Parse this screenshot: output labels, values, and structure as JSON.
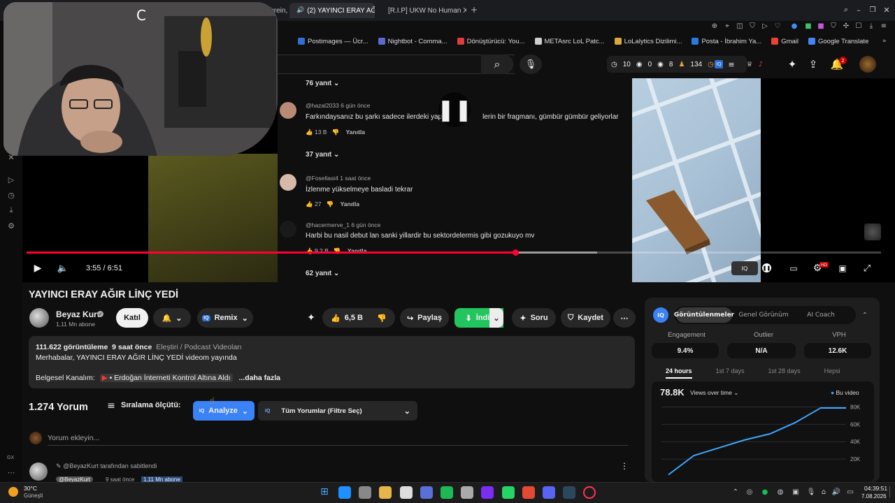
{
  "browser": {
    "tabs": [
      {
        "label": "Bahrein, c"
      },
      {
        "label": "(2) YAYINCI ERAY AĞIR"
      },
      {
        "label": "[R.I.P] UKW No Human Xen"
      }
    ],
    "new_tab": "+",
    "bookmarks": [
      {
        "label": "Postimages — Ücr...",
        "color": "#2f6fd6"
      },
      {
        "label": "Nightbot - Comma...",
        "color": "#5b6ad0"
      },
      {
        "label": "Dönüştürücü: You...",
        "color": "#e23b3b"
      },
      {
        "label": "METAsrc LoL Patc...",
        "color": "#cfcfcf"
      },
      {
        "label": "LoLalytics Dizilimi...",
        "color": "#d9a93a"
      },
      {
        "label": "Posta - İbrahim Ya...",
        "color": "#2a7be0"
      },
      {
        "label": "Gmail",
        "color": "#ea4335"
      },
      {
        "label": "Google Translate",
        "color": "#4285f4"
      }
    ]
  },
  "header": {
    "stats": [
      {
        "icon": "clock-icon",
        "value": "10"
      },
      {
        "icon": "eye-icon",
        "value": "0"
      },
      {
        "icon": "eye-icon",
        "value": "8"
      },
      {
        "icon": "people-icon",
        "value": "134"
      },
      {
        "icon": "clock-icon",
        "value": "3"
      }
    ],
    "notifications": "2"
  },
  "video_comments": {
    "items": [
      {
        "replies": "76 yanıt"
      },
      {
        "user": "@hazal2033",
        "time": "6 gün önce",
        "text": "Farkındaysanız bu şarkı sadece ilerdeki yap",
        "text_tail": "lerin bir fragmanı, gümbür gümbür geliyorlar",
        "likes": "13 B",
        "reply": "Yanıtla"
      },
      {
        "replies": "37 yanıt"
      },
      {
        "user": "@Fosellasi4",
        "time": "1 saat önce",
        "text": "İzlenme yükselmeye basladi tekrar",
        "likes": "27",
        "reply": "Yanıtla"
      },
      {
        "user": "@hacermerve_1",
        "time": "6 gün önce",
        "text": "Harbi bu nasil debut lan sanki yillardir bu sektordelermis gibi gozukuyo mv",
        "likes": "9,2 B",
        "reply": "Yanıtla"
      },
      {
        "replies": "62 yanıt"
      }
    ]
  },
  "player": {
    "time": "3:55 / 6:51",
    "progress": 0.5722,
    "buffered": 0.668,
    "hd_badge": "HD"
  },
  "video": {
    "title": "YAYINCI ERAY AĞIR LİNÇ YEDİ",
    "channel": "Beyaz Kurt",
    "subscribers": "1,11 Mn abone",
    "join": "Katıl",
    "remix": "Remix",
    "likes": "6,5 B",
    "share": "Paylaş",
    "download": "İndir",
    "ask": "Soru",
    "save": "Kaydet"
  },
  "description": {
    "views": "111.622 görüntüleme",
    "age": "9 saat önce",
    "tags": "Eleştiri / Podcast Videoları",
    "line1": "Merhabalar, YAYINCI ERAY AĞIR LİNÇ YEDİ videom yayında",
    "line2_label": "Belgesel Kanalım:",
    "line2_link": "• Erdoğan İnterneti Kontrol Altına Aldı",
    "more": "...daha fazla"
  },
  "comments": {
    "count": "1.274 Yorum",
    "sort": "Sıralama ölçütü:",
    "analyze": "Analyze",
    "filter": "Tüm Yorumlar (Filtre Seç)",
    "add_placeholder": "Yorum ekleyin...",
    "pinned": "@BeyazKurt tarafından sabitlendi",
    "pinned_user": "@BeyazKurt",
    "pinned_time": "9 saat önce",
    "pinned_subs": "1,11 Mn abone"
  },
  "analytics": {
    "tabs": [
      "Görüntülenmeler",
      "Genel Görünüm",
      "AI Coach"
    ],
    "metrics": [
      {
        "label": "Engagement",
        "value": "9.4%"
      },
      {
        "label": "Outlier",
        "value": "N/A"
      },
      {
        "label": "VPH",
        "value": "12.6K"
      }
    ],
    "ranges": [
      "24 hours",
      "1st 7 days",
      "1st 28 days",
      "Hepsi"
    ],
    "total": "78.8K",
    "chart_title": "Views over time",
    "legend": "Bu video",
    "accent": "#3ea6ff"
  },
  "chart_data": {
    "type": "line",
    "y_ticks": [
      "80K",
      "60K",
      "40K",
      "20K"
    ],
    "ylim": [
      0,
      90000
    ],
    "series": [
      {
        "name": "Bu video",
        "values": [
          2000,
          24000,
          33000,
          42000,
          49000,
          62000,
          78800,
          78800
        ]
      }
    ]
  },
  "taskbar": {
    "weather_temp": "30°C",
    "weather_desc": "Güneşli",
    "time": "04:39:51",
    "date": "7.08.2026",
    "app_colors": [
      "#1e90ff",
      "#888",
      "#e8b54a",
      "#ddd",
      "#5a6fd8",
      "#1db954",
      "#aaa",
      "#7b2df0",
      "#25d366",
      "#e34a33",
      "#5865f2",
      "#2a475e",
      "#ff3355"
    ]
  },
  "sidebar": {
    "gx_label": "GX"
  }
}
